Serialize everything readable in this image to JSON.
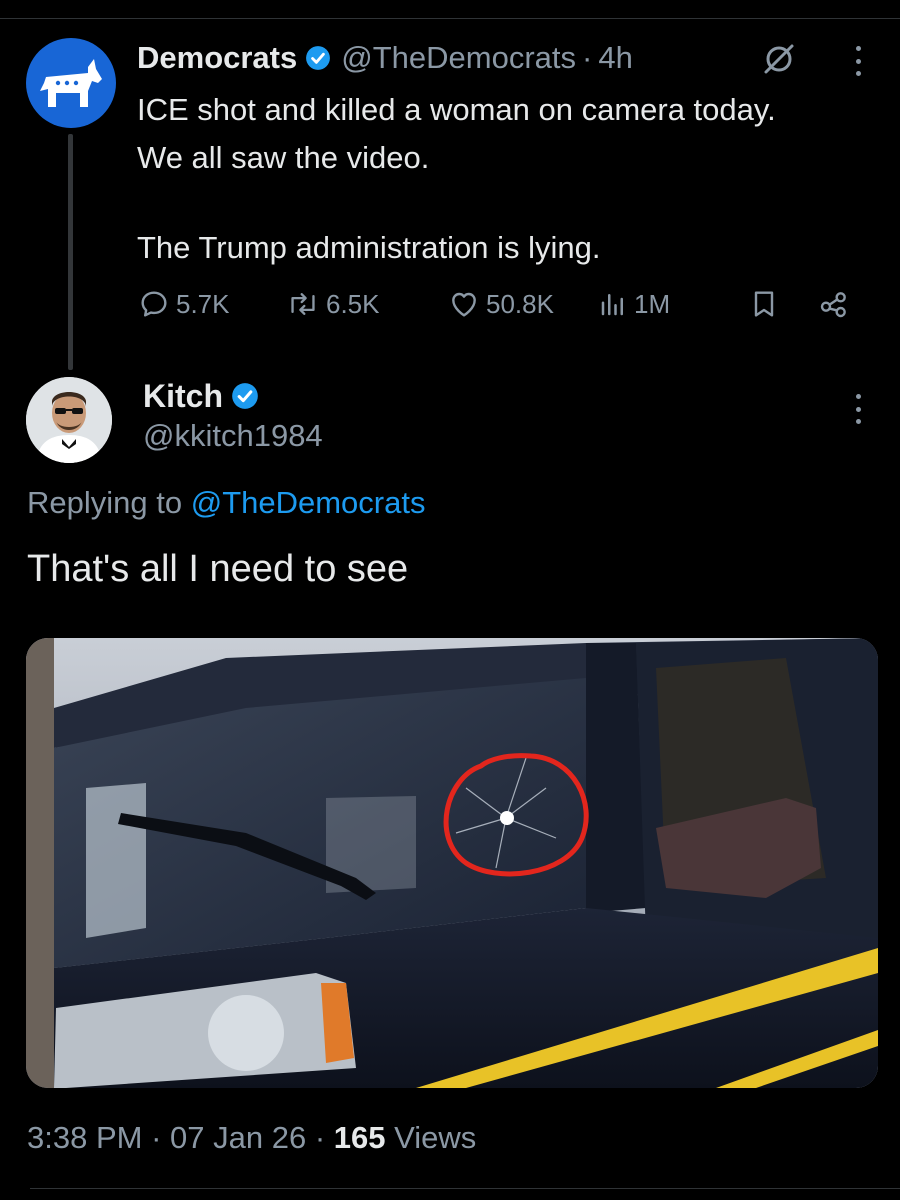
{
  "parent_tweet": {
    "author_name": "Democrats",
    "handle": "@TheDemocrats",
    "separator": "·",
    "age": "4h",
    "text_line_1": "ICE shot and killed a woman on camera today.",
    "text_line_2": "We all saw the video.",
    "text_line_3": "The Trump administration is lying.",
    "replies": "5.7K",
    "reposts": "6.5K",
    "likes": "50.8K",
    "views": "1M"
  },
  "reply_tweet": {
    "author_name": "Kitch",
    "handle": "@kkitch1984",
    "replying_prefix": "Replying to",
    "replying_to": "@TheDemocrats",
    "text": "That's all I need to see",
    "time": "3:38 PM",
    "date": "07 Jan 26",
    "separator": "·",
    "views_count": "165",
    "views_label": "Views"
  },
  "icons": {
    "verified": "verified-badge-icon",
    "grok": "grok-icon",
    "more": "more-vertical-icon",
    "reply": "reply-icon",
    "repost": "repost-icon",
    "like": "heart-icon",
    "views": "analytics-icon",
    "bookmark": "bookmark-icon",
    "share": "share-icon"
  },
  "colors": {
    "background": "#000000",
    "text_primary": "#e7e9ea",
    "text_secondary": "#8b98a5",
    "link": "#1d9bf0",
    "verified": "#1d9bf0",
    "democrats_blue": "#1866d6"
  }
}
